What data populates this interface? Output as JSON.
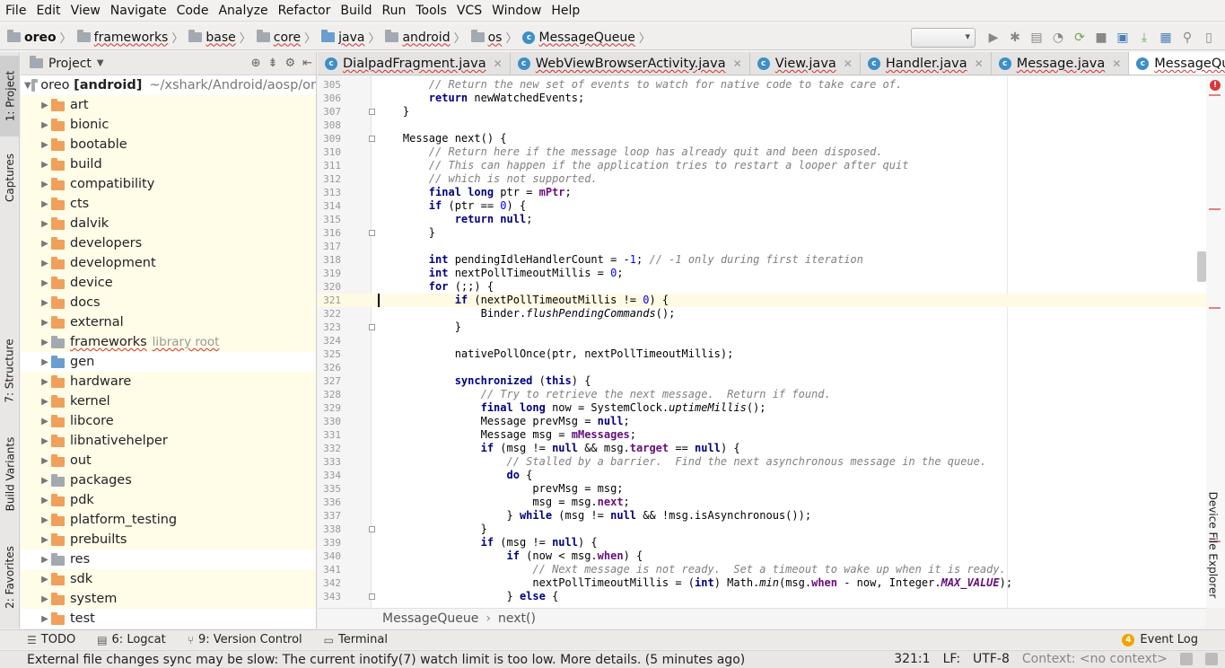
{
  "menu": [
    "File",
    "Edit",
    "View",
    "Navigate",
    "Code",
    "Analyze",
    "Refactor",
    "Build",
    "Run",
    "Tools",
    "VCS",
    "Window",
    "Help"
  ],
  "breadcrumbs": [
    "oreo",
    "frameworks",
    "base",
    "core",
    "java",
    "android",
    "os",
    "MessageQueue"
  ],
  "left_tools": {
    "project": "1: Project",
    "captures": "Captures",
    "structure": "7: Structure",
    "build_variants": "Build Variants",
    "favorites": "2: Favorites"
  },
  "project_panel": {
    "title": "Project",
    "root_name": "oreo",
    "root_module": "[android]",
    "root_path": "~/xshark/Android/aosp/or",
    "library_root_label": "library root",
    "items": [
      "art",
      "bionic",
      "bootable",
      "build",
      "compatibility",
      "cts",
      "dalvik",
      "developers",
      "development",
      "device",
      "docs",
      "external",
      "frameworks",
      "gen",
      "hardware",
      "kernel",
      "libcore",
      "libnativehelper",
      "out",
      "packages",
      "pdk",
      "platform_testing",
      "prebuilts",
      "res",
      "sdk",
      "system",
      "test"
    ]
  },
  "tabs": [
    "DialpadFragment.java",
    "WebViewBrowserActivity.java",
    "View.java",
    "Handler.java",
    "Message.java",
    "MessageQueue"
  ],
  "code_lines": [
    {
      "n": "305",
      "html": "        <span class=\"cm\">// Return the new set of events to watch for native code to take care of.</span>"
    },
    {
      "n": "306",
      "html": "        <span class=\"kw\">return</span> newWatchedEvents;"
    },
    {
      "n": "307",
      "html": "    }"
    },
    {
      "n": "308",
      "html": ""
    },
    {
      "n": "309",
      "html": "    Message next() {"
    },
    {
      "n": "310",
      "html": "        <span class=\"cm\">// Return here if the message loop has already quit and been disposed.</span>"
    },
    {
      "n": "311",
      "html": "        <span class=\"cm\">// This can happen if the application tries to restart a looper after quit</span>"
    },
    {
      "n": "312",
      "html": "        <span class=\"cm\">// which is not supported.</span>"
    },
    {
      "n": "313",
      "html": "        <span class=\"kw\">final long</span> ptr = <span class=\"fld\">mPtr</span>;"
    },
    {
      "n": "314",
      "html": "        <span class=\"kw\">if</span> (ptr == <span class=\"num\">0</span>) {"
    },
    {
      "n": "315",
      "html": "            <span class=\"kw\">return null</span>;"
    },
    {
      "n": "316",
      "html": "        }"
    },
    {
      "n": "317",
      "html": ""
    },
    {
      "n": "318",
      "html": "        <span class=\"kw\">int</span> pendingIdleHandlerCount = -<span class=\"num\">1</span>; <span class=\"cm\">// -1 only during first iteration</span>"
    },
    {
      "n": "319",
      "html": "        <span class=\"kw\">int</span> nextPollTimeoutMillis = <span class=\"num\">0</span>;"
    },
    {
      "n": "320",
      "html": "        <span class=\"kw\">for</span> (;;) {"
    },
    {
      "n": "321",
      "html": "            <span class=\"kw\">if</span> (nextPollTimeoutMillis != <span class=\"num\">0</span>) {",
      "current": true
    },
    {
      "n": "322",
      "html": "                Binder.<span class=\"it\">flushPendingCommands</span>();"
    },
    {
      "n": "323",
      "html": "            }"
    },
    {
      "n": "324",
      "html": ""
    },
    {
      "n": "325",
      "html": "            nativePollOnce(ptr, nextPollTimeoutMillis);"
    },
    {
      "n": "326",
      "html": ""
    },
    {
      "n": "327",
      "html": "            <span class=\"kw\">synchronized</span> (<span class=\"kw\">this</span>) {"
    },
    {
      "n": "328",
      "html": "                <span class=\"cm\">// Try to retrieve the next message.  Return if found.</span>"
    },
    {
      "n": "329",
      "html": "                <span class=\"kw\">final long</span> now = SystemClock.<span class=\"it\">uptimeMillis</span>();"
    },
    {
      "n": "330",
      "html": "                Message prevMsg = <span class=\"kw\">null</span>;"
    },
    {
      "n": "331",
      "html": "                Message msg = <span class=\"fld\">mMessages</span>;"
    },
    {
      "n": "332",
      "html": "                <span class=\"kw\">if</span> (msg != <span class=\"kw\">null</span> &amp;&amp; msg.<span class=\"fld\">target</span> == <span class=\"kw\">null</span>) {"
    },
    {
      "n": "333",
      "html": "                    <span class=\"cm\">// Stalled by a barrier.  Find the next asynchronous message in the queue.</span>"
    },
    {
      "n": "334",
      "html": "                    <span class=\"kw\">do</span> {"
    },
    {
      "n": "335",
      "html": "                        prevMsg = msg;"
    },
    {
      "n": "336",
      "html": "                        msg = msg.<span class=\"fld\">next</span>;"
    },
    {
      "n": "337",
      "html": "                    } <span class=\"kw\">while</span> (msg != <span class=\"kw\">null</span> &amp;&amp; !msg.isAsynchronous());"
    },
    {
      "n": "338",
      "html": "                }"
    },
    {
      "n": "339",
      "html": "                <span class=\"kw\">if</span> (msg != <span class=\"kw\">null</span>) {"
    },
    {
      "n": "340",
      "html": "                    <span class=\"kw\">if</span> (now &lt; msg.<span class=\"fld\">when</span>) {"
    },
    {
      "n": "341",
      "html": "                        <span class=\"cm\">// Next message is not ready.  Set a timeout to wake up when it is ready.</span>"
    },
    {
      "n": "342",
      "html": "                        nextPollTimeoutMillis = (<span class=\"kw\">int</span>) Math.<span class=\"it\">min</span>(msg.<span class=\"fld\">when</span> - now, Integer.<span class=\"sfld\">MAX_VALUE</span>);"
    },
    {
      "n": "343",
      "html": "                    } <span class=\"kw\">else</span> {"
    }
  ],
  "editor_breadcrumb": [
    "MessageQueue",
    "next()"
  ],
  "right_tool": "Device File Explorer",
  "bottom_tools": {
    "todo": "TODO",
    "logcat": "6: Logcat",
    "vcs": "9: Version Control",
    "terminal": "Terminal",
    "event_log": "Event Log",
    "event_count": "4"
  },
  "status": {
    "message": "External file changes sync may be slow: The current inotify(7) watch limit is too low. More details. (5 minutes ago)",
    "position": "321:1",
    "line_sep": "LF:",
    "encoding": "UTF-8",
    "context": "Context: <no context>"
  },
  "colors": {
    "keyword": "#000080",
    "comment": "#808080",
    "field": "#660e7a",
    "number": "#0000ff",
    "project_bg": "#fffce8",
    "current_line": "#fffae3"
  }
}
